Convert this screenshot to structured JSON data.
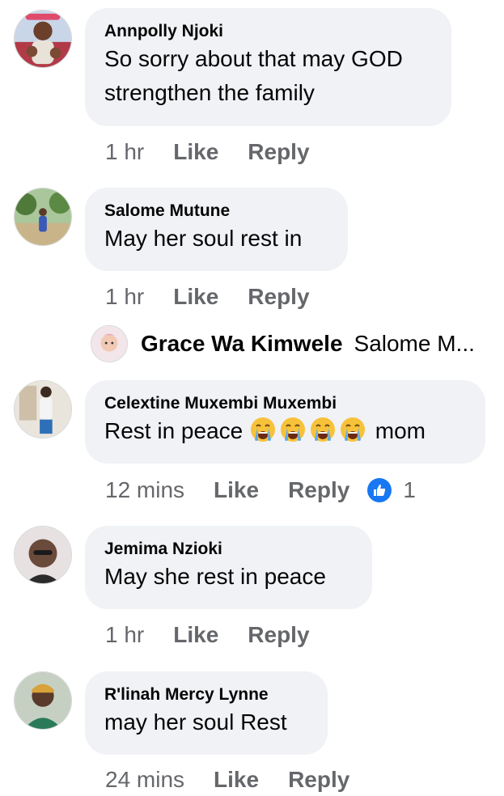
{
  "comments": [
    {
      "author": "Annpolly Njoki",
      "line1": "So sorry about that may GOD",
      "line2": "strengthen the family",
      "time": "1 hr",
      "like": "Like",
      "reply": "Reply"
    },
    {
      "author": "Salome Mutune",
      "line1": "May her soul rest in",
      "time": "1 hr",
      "like": "Like",
      "reply": "Reply"
    },
    {
      "author": "Celextine Muxembi Muxembi",
      "text_before": "Rest in peace",
      "emoji": "loudly-crying-face",
      "emoji_count": 4,
      "text_after": "mom",
      "time": "12 mins",
      "like": "Like",
      "reply": "Reply",
      "reaction_count": "1"
    },
    {
      "author": "Jemima Nzioki",
      "line1": "May she rest in peace",
      "time": "1 hr",
      "like": "Like",
      "reply": "Reply"
    },
    {
      "author": "R'linah Mercy Lynne",
      "line1": "may her soul Rest",
      "time": "24 mins",
      "like": "Like",
      "reply": "Reply"
    }
  ],
  "reply_preview": {
    "author": "Grace Wa Kimwele",
    "text": "Salome M..."
  },
  "colors": {
    "bubble": "#f0f2f5",
    "meta": "#65676b",
    "text": "#050505",
    "like_reaction": "#1877f2"
  }
}
